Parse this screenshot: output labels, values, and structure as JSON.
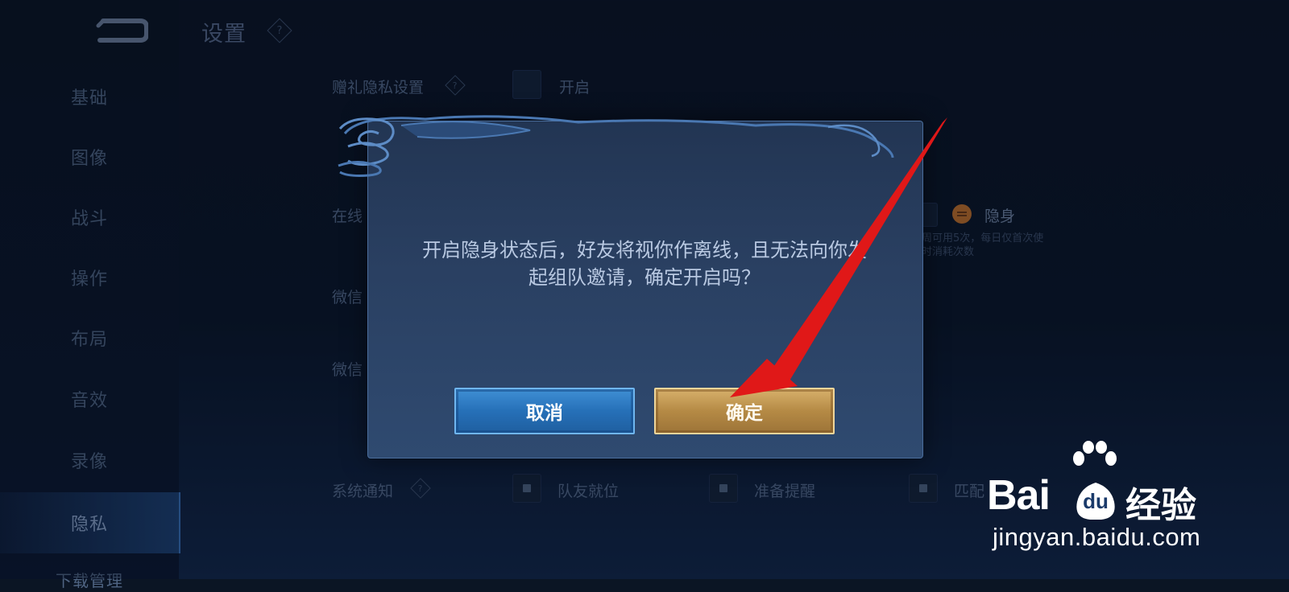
{
  "page": {
    "title": "设置",
    "help_icon": "question-diamond-icon"
  },
  "sidebar": {
    "items": [
      {
        "label": "基础"
      },
      {
        "label": "图像"
      },
      {
        "label": "战斗"
      },
      {
        "label": "操作"
      },
      {
        "label": "布局"
      },
      {
        "label": "音效"
      },
      {
        "label": "录像"
      },
      {
        "label": "隐私",
        "active": true
      },
      {
        "label": "下载管理"
      }
    ]
  },
  "settings": {
    "gift_privacy": {
      "label": "赠礼隐私设置",
      "option": "开启"
    },
    "online": {
      "label": "在线",
      "option": "隐身",
      "note": [
        "周可用5次，每日仅首次使",
        "时消耗次数"
      ]
    },
    "wechat_1": {
      "label": "微信"
    },
    "wechat_2": {
      "label": "微信"
    },
    "system_notice": {
      "label": "系统通知",
      "options": [
        "队友就位",
        "准备提醒",
        "匹配"
      ]
    }
  },
  "dialog": {
    "message_line1": "开启隐身状态后，好友将视你作离线，且无法向你发",
    "message_line2": "起组队邀请，确定开启吗？",
    "cancel_label": "取消",
    "confirm_label": "确定"
  },
  "watermark": {
    "logo_bai": "Bai",
    "logo_du": "du",
    "logo_cn": "经验",
    "url": "jingyan.baidu.com"
  },
  "colors": {
    "accent_blue": "#2670b8",
    "accent_gold": "#b58a45",
    "arrow_red": "#e01818"
  }
}
